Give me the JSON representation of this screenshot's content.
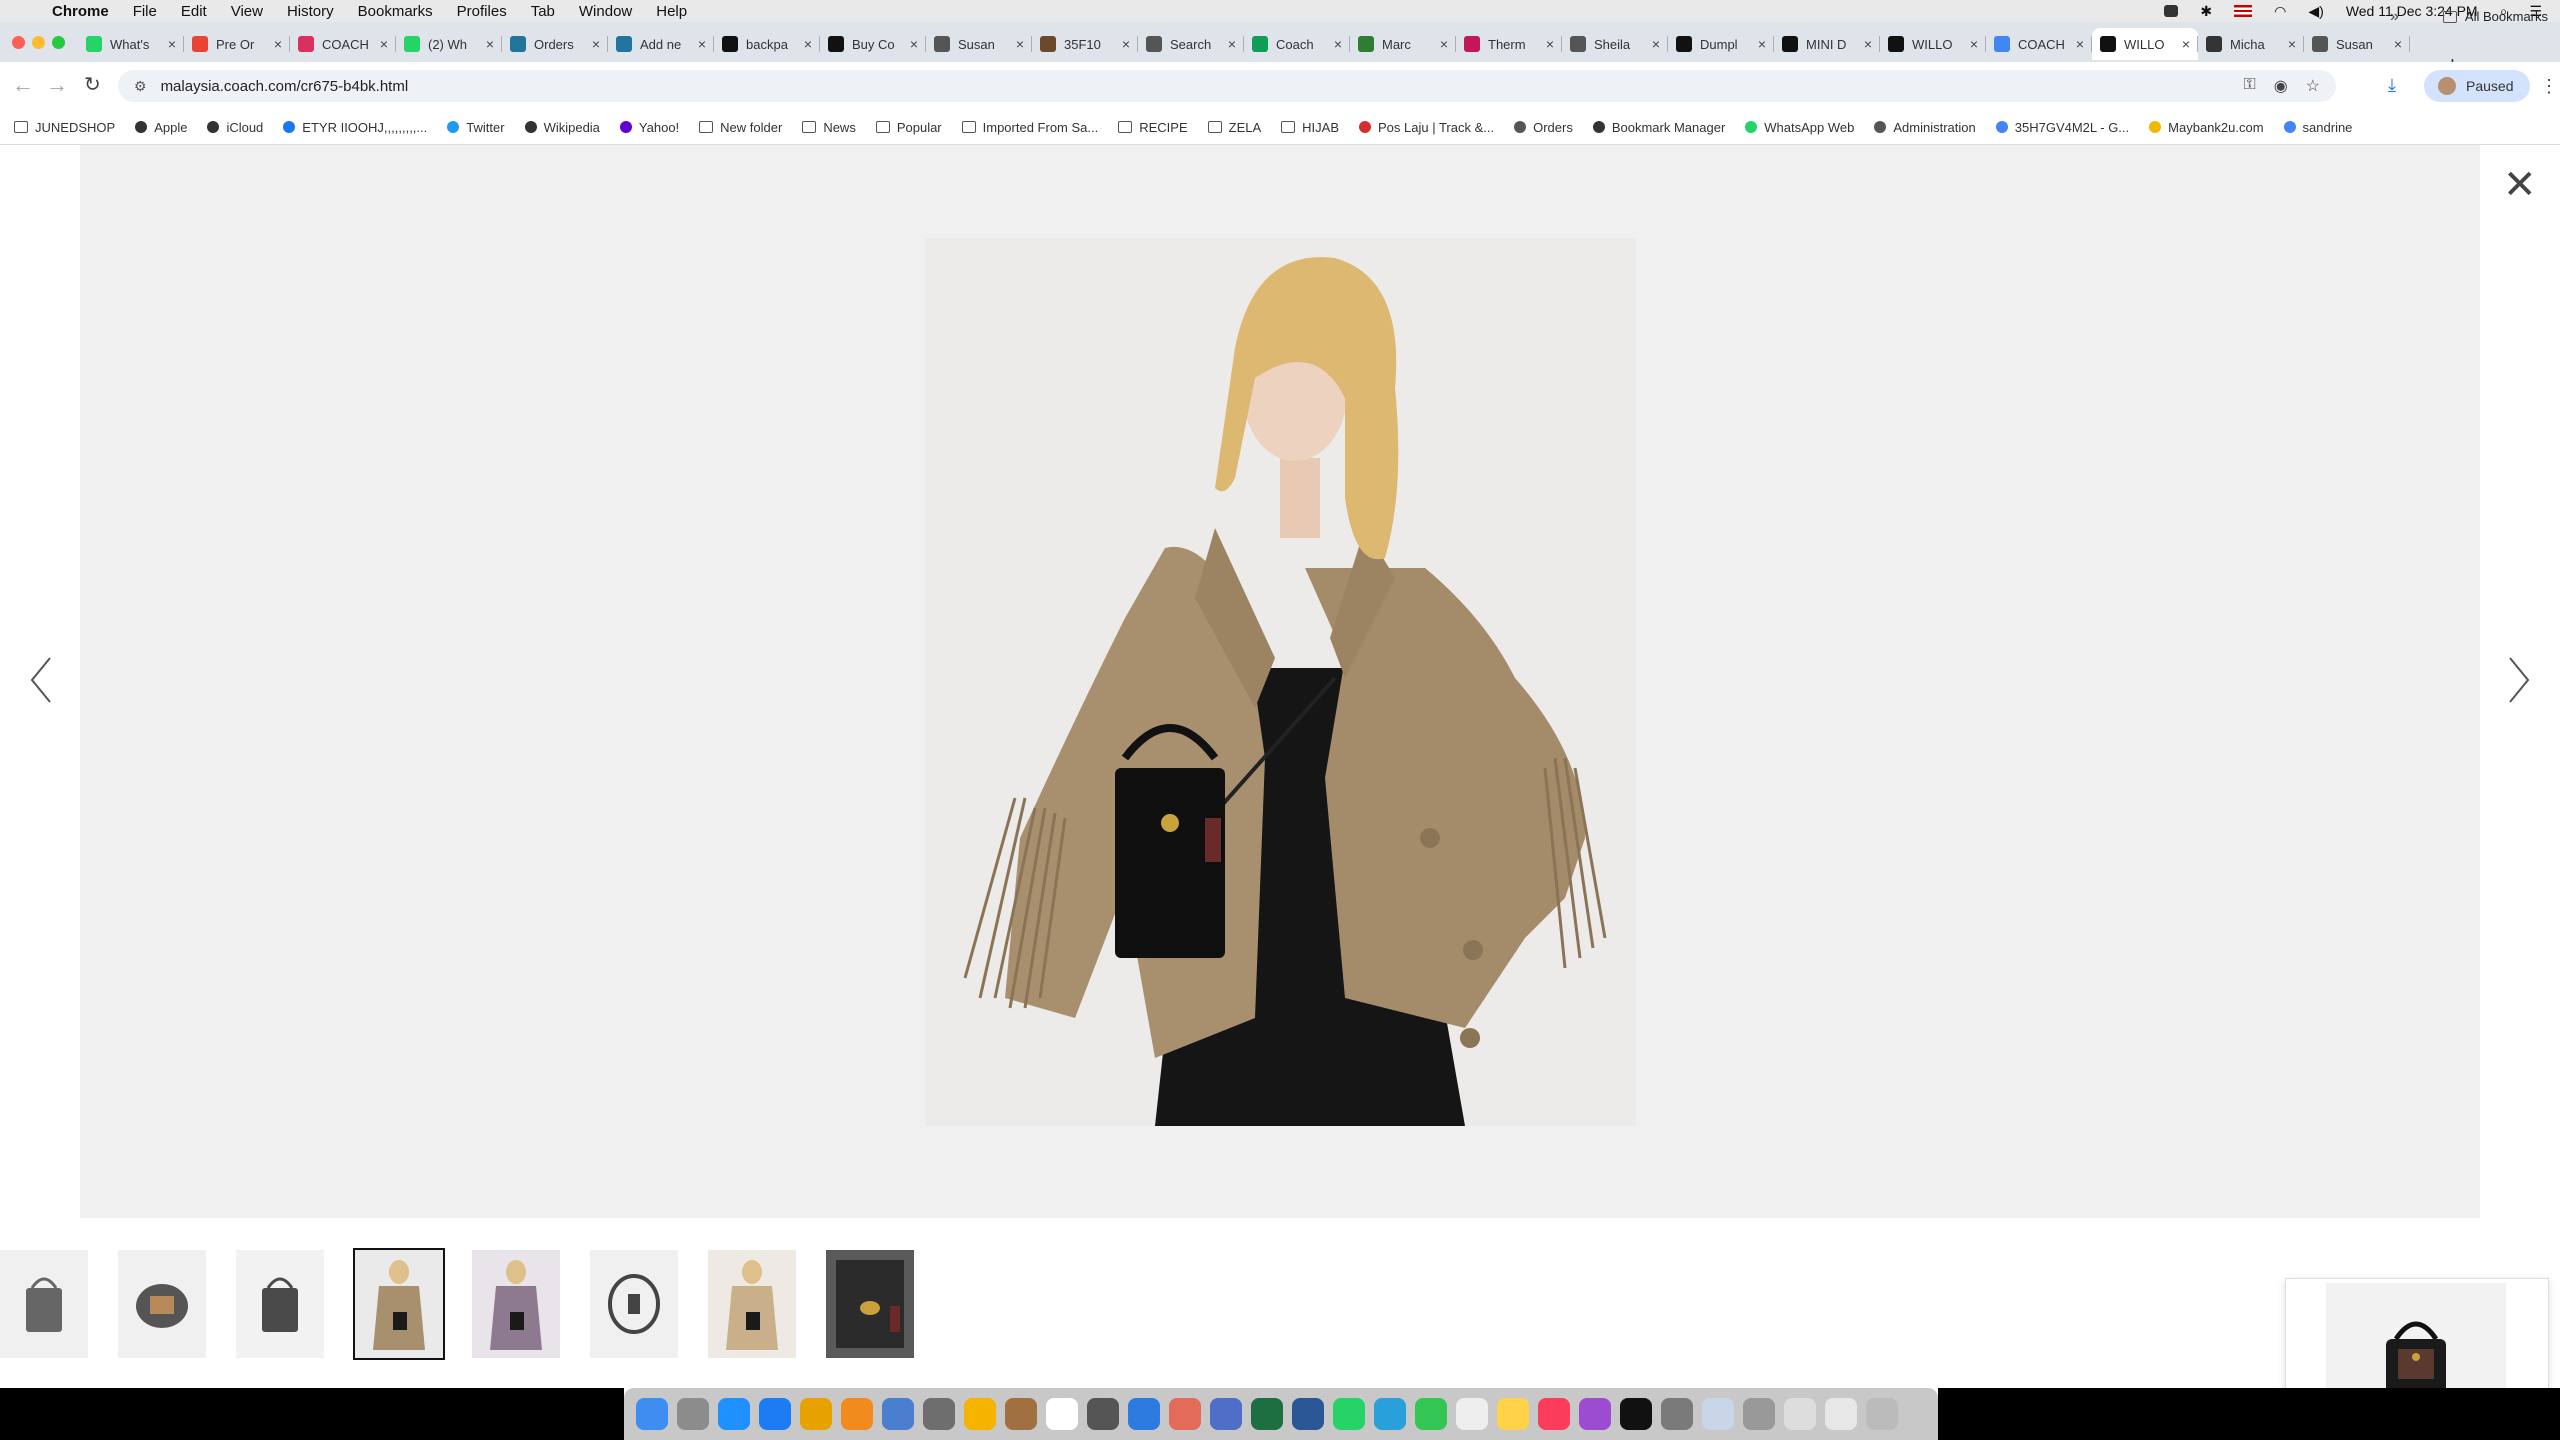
{
  "menubar": {
    "app": "Chrome",
    "items": [
      "File",
      "Edit",
      "View",
      "History",
      "Bookmarks",
      "Profiles",
      "Tab",
      "Window",
      "Help"
    ],
    "clock": "Wed 11 Dec  3:24 PM"
  },
  "tabs": [
    {
      "title": "What's",
      "icon": "whatsapp-icon",
      "color": "#25d366"
    },
    {
      "title": "Pre Or",
      "icon": "gmail-icon",
      "color": "#ea4335"
    },
    {
      "title": "COACH",
      "icon": "heart-icon",
      "color": "#d93060"
    },
    {
      "title": "(2) Wh",
      "icon": "whatsapp-icon",
      "color": "#25d366"
    },
    {
      "title": "Orders",
      "icon": "wordpress-icon",
      "color": "#21759b"
    },
    {
      "title": "Add ne",
      "icon": "wordpress-icon",
      "color": "#21759b"
    },
    {
      "title": "backpa",
      "icon": "coach-icon",
      "color": "#111111"
    },
    {
      "title": "Buy Co",
      "icon": "coach-icon",
      "color": "#111111"
    },
    {
      "title": "Susan",
      "icon": "gmail-icon",
      "color": "#555555"
    },
    {
      "title": "35F10",
      "icon": "circle-icon",
      "color": "#6b4a2b"
    },
    {
      "title": "Search",
      "icon": "gmail-icon",
      "color": "#555555"
    },
    {
      "title": "Coach",
      "icon": "sheets-icon",
      "color": "#0f9d58"
    },
    {
      "title": "Marc",
      "icon": "globe-icon",
      "color": "#2e7d32"
    },
    {
      "title": "Therm",
      "icon": "box-icon",
      "color": "#c2185b"
    },
    {
      "title": "Sheila",
      "icon": "gmail-icon",
      "color": "#555555"
    },
    {
      "title": "Dumpl",
      "icon": "spade-icon",
      "color": "#111111"
    },
    {
      "title": "MINI D",
      "icon": "spade-icon",
      "color": "#111111"
    },
    {
      "title": "WILLO",
      "icon": "coach-icon",
      "color": "#111111"
    },
    {
      "title": "COACH",
      "icon": "google-icon",
      "color": "#4285f4"
    },
    {
      "title": "WILLO",
      "icon": "coach-icon",
      "color": "#111111",
      "active": true
    },
    {
      "title": "Micha",
      "icon": "michael-icon",
      "color": "#333333"
    },
    {
      "title": "Susan",
      "icon": "gmail-icon",
      "color": "#555555"
    }
  ],
  "toolbar": {
    "url": "malaysia.coach.com/cr675-b4bk.html",
    "profile_label": "Paused"
  },
  "bookmarks": [
    {
      "label": "JUNEDSHOP",
      "icon": "folder-icon"
    },
    {
      "label": "Apple",
      "icon": "apple-icon"
    },
    {
      "label": "iCloud",
      "icon": "apple-icon"
    },
    {
      "label": "ETYR  IIOOHJ,,,,,,,,,...",
      "icon": "facebook-icon"
    },
    {
      "label": "Twitter",
      "icon": "twitter-icon"
    },
    {
      "label": "Wikipedia",
      "icon": "wikipedia-icon"
    },
    {
      "label": "Yahoo!",
      "icon": "yahoo-icon"
    },
    {
      "label": "New folder",
      "icon": "folder-icon"
    },
    {
      "label": "News",
      "icon": "folder-icon"
    },
    {
      "label": "Popular",
      "icon": "folder-icon"
    },
    {
      "label": "Imported From Sa...",
      "icon": "folder-icon"
    },
    {
      "label": "RECIPE",
      "icon": "folder-icon"
    },
    {
      "label": "ZELA",
      "icon": "folder-icon"
    },
    {
      "label": "HIJAB",
      "icon": "folder-icon"
    },
    {
      "label": "Pos Laju | Track &...",
      "icon": "poslaju-icon"
    },
    {
      "label": "Orders",
      "icon": "globe-icon"
    },
    {
      "label": "Bookmark Manager",
      "icon": "star-icon"
    },
    {
      "label": "WhatsApp Web",
      "icon": "whatsapp-icon"
    },
    {
      "label": "Administration",
      "icon": "globe-icon"
    },
    {
      "label": "35H7GV4M2L - G...",
      "icon": "google-icon"
    },
    {
      "label": "Maybank2u.com",
      "icon": "maybank-icon"
    },
    {
      "label": "sandrine",
      "icon": "google-icon"
    }
  ],
  "all_bookmarks": "All Bookmarks",
  "gallery": {
    "selected_index": 3,
    "thumbnails": [
      "tote-front",
      "tote-interior",
      "tote-side",
      "model-fringe-jacket",
      "model-plaid-coat",
      "tote-top",
      "model-beige-coat",
      "tote-closeup"
    ]
  }
}
